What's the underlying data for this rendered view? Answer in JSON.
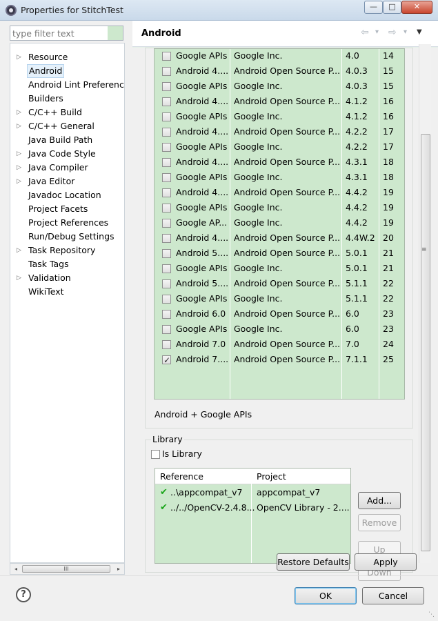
{
  "window": {
    "title": "Properties for StitchTest",
    "min_glyph": "—",
    "max_glyph": "□",
    "close_glyph": "✕"
  },
  "filter": {
    "placeholder": "type filter text"
  },
  "tree": {
    "items": [
      {
        "label": "Resource",
        "arrow": "▷"
      },
      {
        "label": "Android",
        "arrow": "",
        "selected": true
      },
      {
        "label": "Android Lint Preferences",
        "arrow": ""
      },
      {
        "label": "Builders",
        "arrow": ""
      },
      {
        "label": "C/C++ Build",
        "arrow": "▷"
      },
      {
        "label": "C/C++ General",
        "arrow": "▷"
      },
      {
        "label": "Java Build Path",
        "arrow": ""
      },
      {
        "label": "Java Code Style",
        "arrow": "▷"
      },
      {
        "label": "Java Compiler",
        "arrow": "▷"
      },
      {
        "label": "Java Editor",
        "arrow": "▷"
      },
      {
        "label": "Javadoc Location",
        "arrow": ""
      },
      {
        "label": "Project Facets",
        "arrow": ""
      },
      {
        "label": "Project References",
        "arrow": ""
      },
      {
        "label": "Run/Debug Settings",
        "arrow": ""
      },
      {
        "label": "Task Repository",
        "arrow": "▷"
      },
      {
        "label": "Task Tags",
        "arrow": ""
      },
      {
        "label": "Validation",
        "arrow": "▷"
      },
      {
        "label": "WikiText",
        "arrow": ""
      }
    ],
    "scroll_grip": "III",
    "scroll_left": "◂",
    "scroll_right": "▸"
  },
  "page": {
    "title": "Android",
    "back_icon": "⇦",
    "forward_icon": "⇨",
    "dropdown_icon": "▾",
    "menu_icon": "▼",
    "scroll_grip": "≡"
  },
  "targets": {
    "rows": [
      {
        "name": "Google APIs",
        "vendor": "Google Inc.",
        "platform": "4.0",
        "api": "14",
        "checked": false
      },
      {
        "name": "Android 4....",
        "vendor": "Android Open Source P...",
        "platform": "4.0.3",
        "api": "15",
        "checked": false
      },
      {
        "name": "Google APIs",
        "vendor": "Google Inc.",
        "platform": "4.0.3",
        "api": "15",
        "checked": false
      },
      {
        "name": "Android 4....",
        "vendor": "Android Open Source P...",
        "platform": "4.1.2",
        "api": "16",
        "checked": false
      },
      {
        "name": "Google APIs",
        "vendor": "Google Inc.",
        "platform": "4.1.2",
        "api": "16",
        "checked": false
      },
      {
        "name": "Android 4....",
        "vendor": "Android Open Source P...",
        "platform": "4.2.2",
        "api": "17",
        "checked": false
      },
      {
        "name": "Google APIs",
        "vendor": "Google Inc.",
        "platform": "4.2.2",
        "api": "17",
        "checked": false
      },
      {
        "name": "Android 4....",
        "vendor": "Android Open Source P...",
        "platform": "4.3.1",
        "api": "18",
        "checked": false
      },
      {
        "name": "Google APIs",
        "vendor": "Google Inc.",
        "platform": "4.3.1",
        "api": "18",
        "checked": false
      },
      {
        "name": "Android 4....",
        "vendor": "Android Open Source P...",
        "platform": "4.4.2",
        "api": "19",
        "checked": false
      },
      {
        "name": "Google APIs",
        "vendor": "Google Inc.",
        "platform": "4.4.2",
        "api": "19",
        "checked": false
      },
      {
        "name": "Google AP...",
        "vendor": "Google Inc.",
        "platform": "4.4.2",
        "api": "19",
        "checked": false
      },
      {
        "name": "Android 4....",
        "vendor": "Android Open Source P...",
        "platform": "4.4W.2",
        "api": "20",
        "checked": false
      },
      {
        "name": "Android 5....",
        "vendor": "Android Open Source P...",
        "platform": "5.0.1",
        "api": "21",
        "checked": false
      },
      {
        "name": "Google APIs",
        "vendor": "Google Inc.",
        "platform": "5.0.1",
        "api": "21",
        "checked": false
      },
      {
        "name": "Android 5....",
        "vendor": "Android Open Source P...",
        "platform": "5.1.1",
        "api": "22",
        "checked": false
      },
      {
        "name": "Google APIs",
        "vendor": "Google Inc.",
        "platform": "5.1.1",
        "api": "22",
        "checked": false
      },
      {
        "name": "Android 6.0",
        "vendor": "Android Open Source P...",
        "platform": "6.0",
        "api": "23",
        "checked": false
      },
      {
        "name": "Google APIs",
        "vendor": "Google Inc.",
        "platform": "6.0",
        "api": "23",
        "checked": false
      },
      {
        "name": "Android 7.0",
        "vendor": "Android Open Source P...",
        "platform": "7.0",
        "api": "24",
        "checked": false
      },
      {
        "name": "Android 7....",
        "vendor": "Android Open Source P...",
        "platform": "7.1.1",
        "api": "25",
        "checked": true
      }
    ],
    "summary": "Android + Google APIs"
  },
  "library": {
    "group_title": "Library",
    "is_library_label": "Is Library",
    "is_library_checked": false,
    "columns": {
      "reference": "Reference",
      "project": "Project"
    },
    "rows": [
      {
        "reference": "..\\appcompat_v7",
        "project": "appcompat_v7",
        "status_icon": "✔"
      },
      {
        "reference": "../../OpenCV-2.4.8...",
        "project": "OpenCV Library - 2....",
        "status_icon": "✔"
      }
    ],
    "buttons": {
      "add": "Add...",
      "remove": "Remove",
      "up": "Up",
      "down": "Down"
    }
  },
  "actions": {
    "restore_defaults": "Restore Defaults",
    "apply": "Apply",
    "ok": "OK",
    "cancel": "Cancel",
    "help": "?"
  },
  "colors": {
    "table_bg": "#cde8cd",
    "check_green": "#1aa51a",
    "selection_bg": "#e5f1fb"
  }
}
